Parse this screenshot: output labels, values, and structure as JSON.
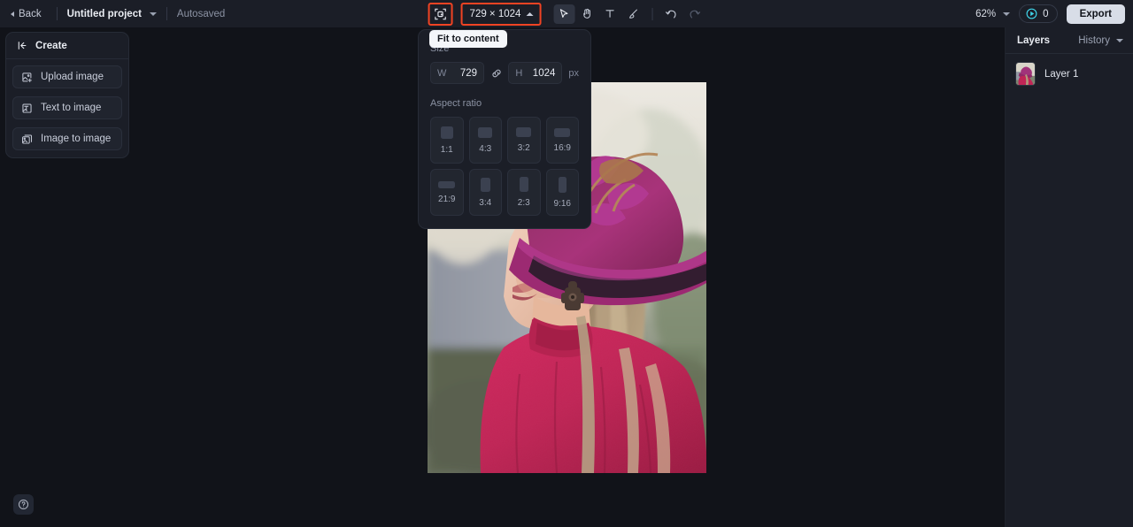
{
  "topbar": {
    "back_label": "Back",
    "project_name": "Untitled project",
    "autosaved_label": "Autosaved",
    "size_chip_label": "729 × 1024",
    "zoom_label": "62%",
    "credits_count": "0",
    "export_label": "Export",
    "tools": [
      {
        "name": "fit-to-content",
        "highlighted": true
      },
      {
        "name": "select-tool",
        "active": true
      },
      {
        "name": "hand-tool",
        "active": false
      },
      {
        "name": "text-tool",
        "active": false
      },
      {
        "name": "brush-tool",
        "active": false
      },
      {
        "name": "undo",
        "active": false
      },
      {
        "name": "redo",
        "active": false
      }
    ]
  },
  "create_panel": {
    "title": "Create",
    "items": [
      {
        "label": "Upload image",
        "icon": "upload-image-icon"
      },
      {
        "label": "Text to image",
        "icon": "text-to-image-icon"
      },
      {
        "label": "Image to image",
        "icon": "image-to-image-icon"
      }
    ]
  },
  "tooltip": {
    "text": "Fit to content"
  },
  "size_popover": {
    "size_label": "Size",
    "width_label": "W",
    "width_value": "729",
    "height_label": "H",
    "height_value": "1024",
    "unit_label": "px",
    "link_icon": "link-ratio-icon",
    "aspect_label": "Aspect ratio",
    "ratios": [
      {
        "label": "1:1",
        "w": 14,
        "h": 14
      },
      {
        "label": "4:3",
        "w": 16,
        "h": 12
      },
      {
        "label": "3:2",
        "w": 17,
        "h": 11
      },
      {
        "label": "16:9",
        "w": 18,
        "h": 10
      },
      {
        "label": "21:9",
        "w": 19,
        "h": 8
      },
      {
        "label": "3:4",
        "w": 11,
        "h": 16
      },
      {
        "label": "2:3",
        "w": 10,
        "h": 17
      },
      {
        "label": "9:16",
        "w": 9,
        "h": 18
      }
    ]
  },
  "right_panel": {
    "layers_tab": "Layers",
    "history_tab": "History",
    "layers": [
      {
        "name": "Layer 1"
      }
    ]
  },
  "help": {
    "icon": "help-circle-icon"
  },
  "colors": {
    "accent_red": "#f04323",
    "credit_cyan": "#3fd3e8",
    "panel_bg": "#1b1e27",
    "canvas_bg": "#111319",
    "export_bg": "#d8dde7"
  }
}
